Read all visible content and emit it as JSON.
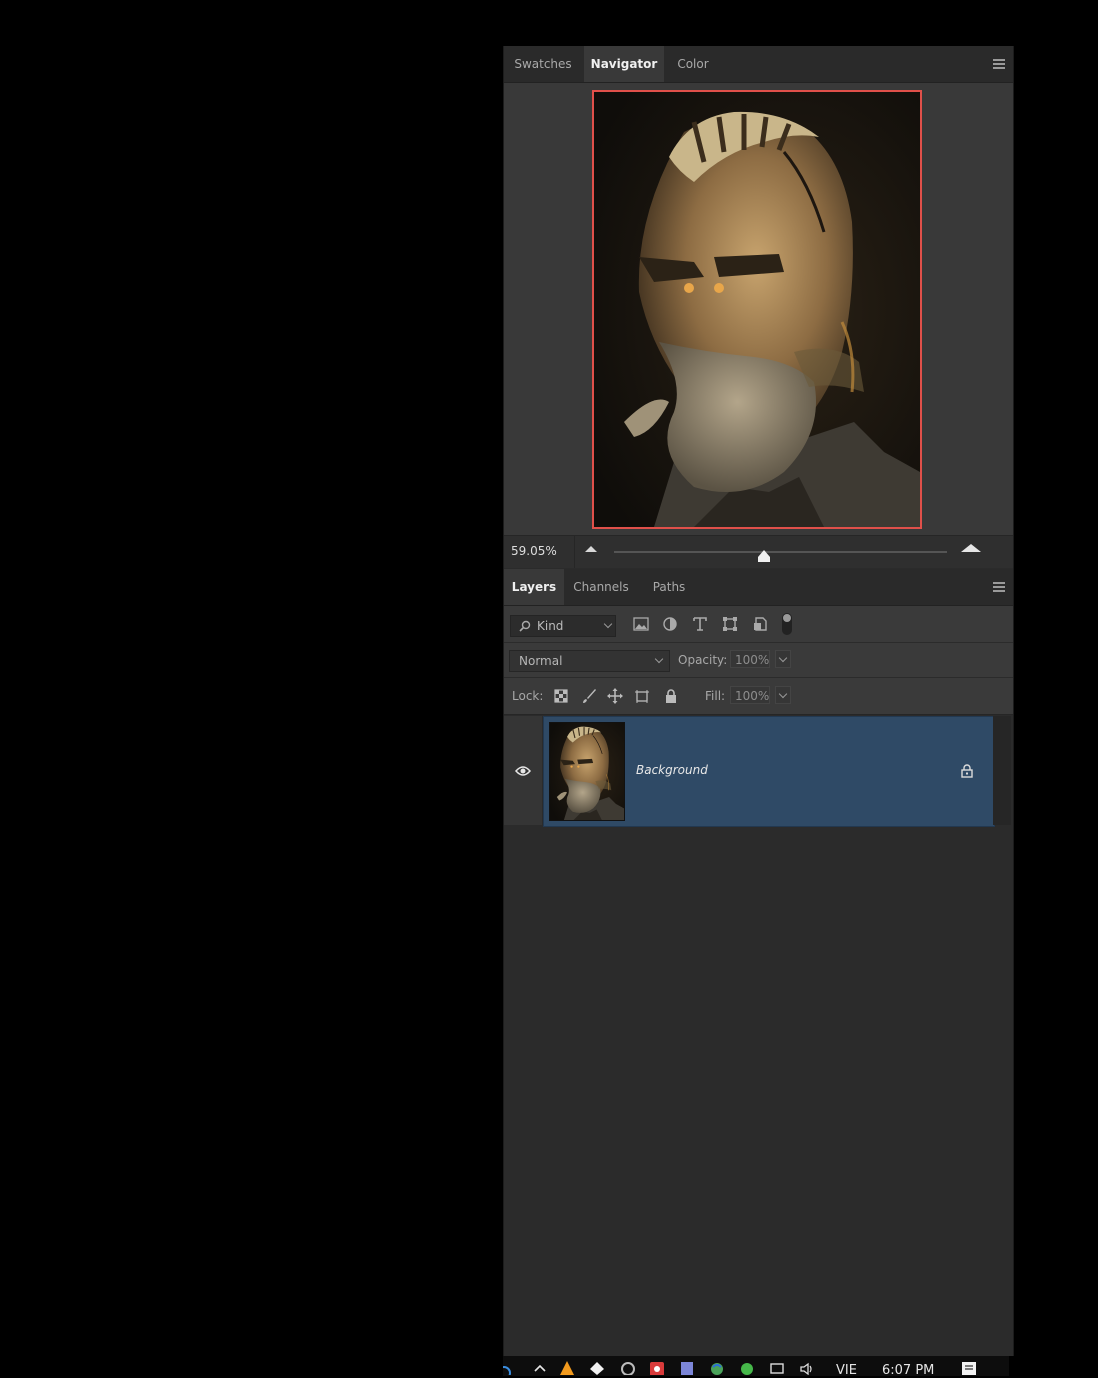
{
  "navigator_panel": {
    "tabs": [
      {
        "label": "Swatches",
        "active": false
      },
      {
        "label": "Navigator",
        "active": true
      },
      {
        "label": "Color",
        "active": false
      }
    ],
    "zoom_level": "59.05%",
    "zoom_slider_value": 0.45,
    "view_box_color": "#e0504a"
  },
  "layers_panel": {
    "tabs": [
      {
        "label": "Layers",
        "active": true
      },
      {
        "label": "Channels",
        "active": false
      },
      {
        "label": "Paths",
        "active": false
      }
    ],
    "filter": {
      "kind_label": "Kind",
      "icons": [
        "pixel-filter-icon",
        "adjustment-filter-icon",
        "type-filter-icon",
        "shape-filter-icon",
        "smart-object-filter-icon"
      ]
    },
    "blend_mode": "Normal",
    "opacity_label": "Opacity:",
    "opacity_value": "100%",
    "lock_label": "Lock:",
    "lock_icons": [
      "lock-transparent-pixels-icon",
      "lock-image-pixels-icon",
      "lock-position-icon",
      "lock-artboard-icon",
      "lock-all-icon"
    ],
    "fill_label": "Fill:",
    "fill_value": "100%",
    "layers": [
      {
        "name": "Background",
        "visible": true,
        "locked": true,
        "selected": true
      }
    ],
    "selection_color": "#2f4a66"
  },
  "taskbar": {
    "language": "VIE",
    "time": "6:07 PM"
  }
}
